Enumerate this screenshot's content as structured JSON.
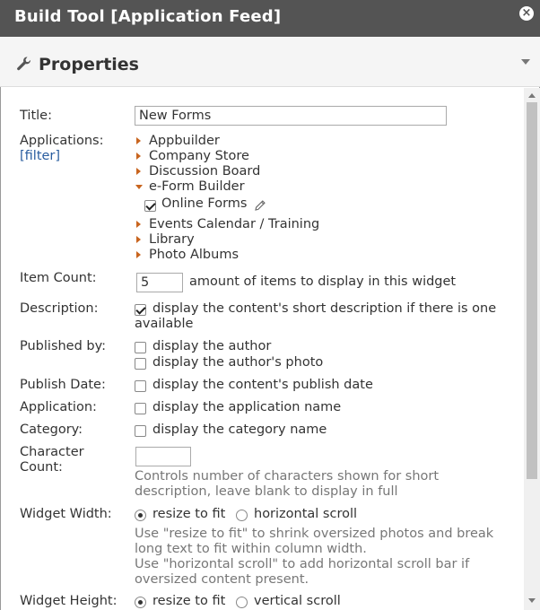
{
  "window": {
    "title": "Build Tool [Application Feed]"
  },
  "panel": {
    "title": "Properties"
  },
  "form": {
    "title_label": "Title:",
    "title_value": "New Forms",
    "applications_label": "Applications:",
    "filter_link": "[filter]",
    "applications": [
      {
        "label": "Appbuilder"
      },
      {
        "label": "Company Store"
      },
      {
        "label": "Discussion Board"
      },
      {
        "label": "e-Form Builder",
        "children": [
          {
            "label": "Online Forms",
            "checked": true
          }
        ]
      },
      {
        "label": "Events Calendar / Training"
      },
      {
        "label": "Library"
      },
      {
        "label": "Photo Albums"
      }
    ],
    "item_count_label": "Item Count:",
    "item_count_value": "5",
    "item_count_help": "amount of items to display in this widget",
    "description_label": "Description:",
    "description_option_line1": "display the content's short description if there is one",
    "description_option_line2": "available",
    "published_by_label": "Published by:",
    "published_author": "display the author",
    "published_photo": "display the author's photo",
    "publish_date_label": "Publish Date:",
    "publish_date_option": "display the content's publish date",
    "application_label": "Application:",
    "application_option": "display the application name",
    "category_label": "Category:",
    "category_option": "display the category name",
    "char_count_label_line1": "Character",
    "char_count_label_line2": "Count:",
    "char_count_help_line1": "Controls number of characters shown for short",
    "char_count_help_line2": "description, leave blank to display in full",
    "widget_width_label": "Widget Width:",
    "width_resize": "resize to fit",
    "width_scroll": "horizontal scroll",
    "width_help_line1": "Use \"resize to fit\" to shrink oversized photos and break",
    "width_help_line2": "long text to fit within column width.",
    "width_help_line3": "Use \"horizontal scroll\" to add horizontal scroll bar if",
    "width_help_line4": "oversized content present.",
    "widget_height_label": "Widget Height:",
    "height_resize": "resize to fit",
    "height_scroll": "vertical scroll"
  },
  "colors": {
    "titlebar": "#545454",
    "tree_arrow": "#c8641e",
    "link": "#2a5d9f"
  },
  "icons": {
    "close": "close-icon",
    "wrench": "wrench-icon",
    "collapse": "chevron-down-icon",
    "edit": "pencil-icon"
  }
}
